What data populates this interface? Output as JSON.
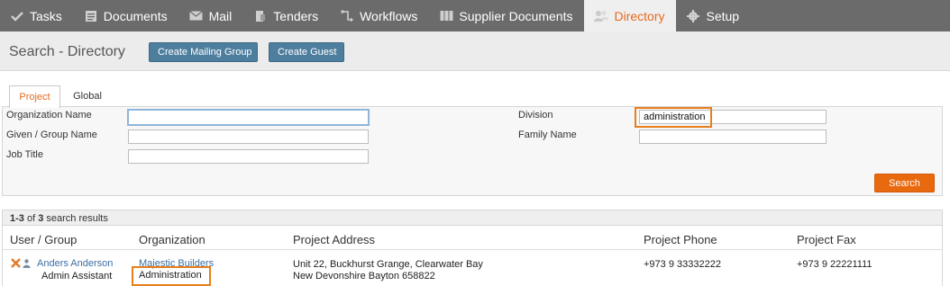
{
  "nav": {
    "items": [
      {
        "label": "Tasks",
        "icon": "check-icon"
      },
      {
        "label": "Documents",
        "icon": "document-icon"
      },
      {
        "label": "Mail",
        "icon": "envelope-icon"
      },
      {
        "label": "Tenders",
        "icon": "tender-icon"
      },
      {
        "label": "Workflows",
        "icon": "workflow-icon"
      },
      {
        "label": "Supplier Documents",
        "icon": "supplier-documents-icon"
      },
      {
        "label": "Directory",
        "icon": "people-icon"
      },
      {
        "label": "Setup",
        "icon": "gear-icon"
      }
    ],
    "active": "Directory"
  },
  "header": {
    "title": "Search - Directory",
    "create_mailing_group": "Create Mailing Group",
    "create_guest": "Create Guest"
  },
  "tabs": [
    "Project",
    "Global"
  ],
  "form": {
    "organization_name_label": "Organization Name",
    "organization_name_value": "",
    "given_group_name_label": "Given / Group Name",
    "given_group_name_value": "",
    "job_title_label": "Job Title",
    "job_title_value": "",
    "division_label": "Division",
    "division_value": "administration",
    "family_name_label": "Family Name",
    "family_name_value": "",
    "search_button": "Search"
  },
  "results": {
    "range": "1-3",
    "of_text": " of ",
    "total": "3",
    "suffix": " search results",
    "columns": [
      "User / Group",
      "Organization",
      "Project Address",
      "Project Phone",
      "Project Fax"
    ],
    "rows": [
      {
        "user": "Anders Anderson",
        "job_title": "Admin Assistant",
        "organization": "Majestic Builders",
        "division": "Administration",
        "address_line1": "Unit 22, Buckhurst Grange, Clearwater Bay",
        "address_line2": "New Devonshire Bayton 658822",
        "phone": "+973 9 33332222",
        "fax": "+973 9 22221111"
      }
    ]
  },
  "colors": {
    "accent": "#e56b1f",
    "nav_bg": "#6b6b6b",
    "button_blue": "#4e7e9e",
    "highlight": "#e87e1c"
  }
}
